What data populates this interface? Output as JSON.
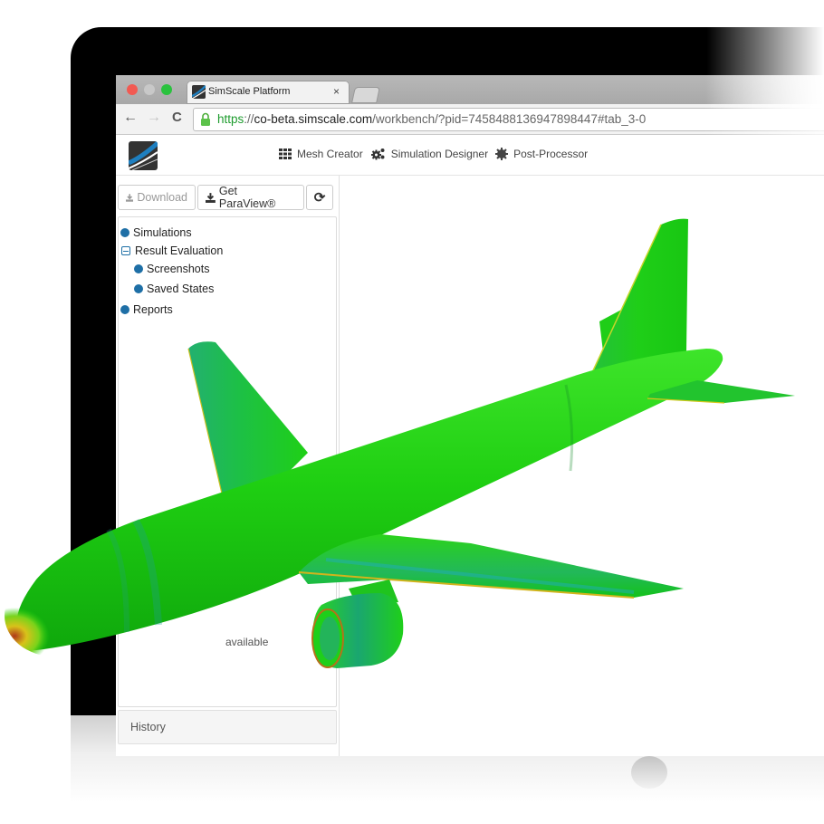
{
  "browser": {
    "tab": {
      "title": "SimScale Platform",
      "close_label": "×"
    },
    "url": {
      "scheme": "https",
      "separator": "://",
      "host": "co-beta.simscale.com",
      "path": "/workbench/?pid=7458488136947898447#tab_3-0"
    },
    "icons": {
      "back": "←",
      "forward": "→",
      "reload": "C"
    }
  },
  "app": {
    "nav": [
      {
        "label": "Mesh Creator",
        "icon": "grid-icon"
      },
      {
        "label": "Simulation Designer",
        "icon": "gears-icon"
      },
      {
        "label": "Post-Processor",
        "icon": "cog-icon"
      }
    ]
  },
  "sidebar": {
    "toolbar": {
      "download_label": "Download",
      "paraview_label": "Get ParaView®",
      "refresh_icon": "⟳"
    },
    "tree": [
      {
        "label": "Simulations",
        "level": 0,
        "type": "leaf"
      },
      {
        "label": "Result Evaluation",
        "level": 0,
        "type": "expanded"
      },
      {
        "label": "Screenshots",
        "level": 1,
        "type": "leaf"
      },
      {
        "label": "Saved States",
        "level": 1,
        "type": "leaf"
      },
      {
        "label": "Reports",
        "level": 0,
        "type": "leaf"
      }
    ],
    "empty_note": "available",
    "history_label": "History"
  },
  "colors": {
    "accent_blue": "#1e6fa6",
    "https_green": "#1e9c2e",
    "model_green": "#1fcf12"
  }
}
